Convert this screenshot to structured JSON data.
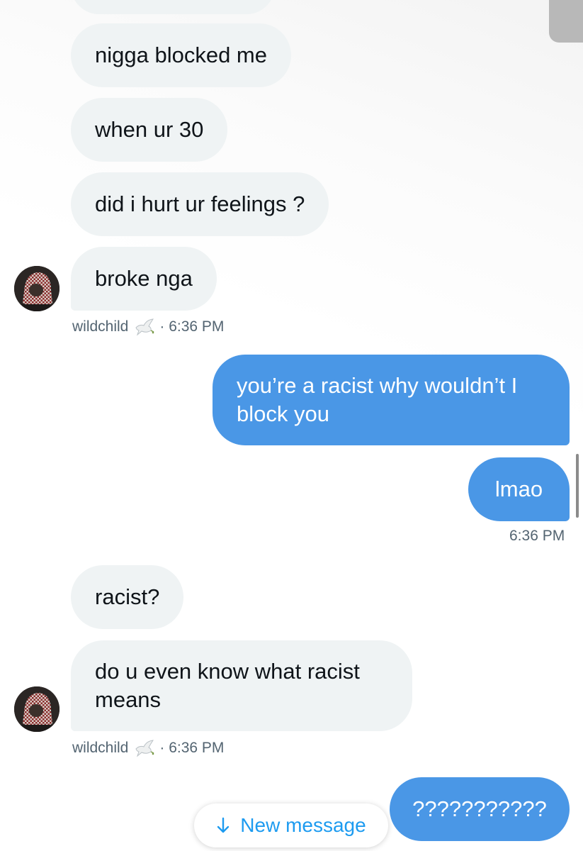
{
  "messages": {
    "received_1": "nigga blocked me",
    "received_2": "when ur 30",
    "received_3": "did i hurt ur feelings ?",
    "received_4": "broke nga",
    "sent_1": "you’re a racist why wouldn’t I block you",
    "sent_2": "lmao",
    "received_5": "racist?",
    "received_6": "do u even know what racist means",
    "sent_3": "???????????"
  },
  "meta": {
    "sender_name_1": "wildchild",
    "sender_time_1": "· 6:36 PM",
    "sent_time_1": "6:36 PM",
    "sender_name_2": "wildchild",
    "sender_time_2": "· 6:36 PM",
    "sender_badge_icon": "dove-icon"
  },
  "new_message_pill": {
    "label": "New message",
    "icon": "arrow-down-icon"
  },
  "colors": {
    "incoming_bubble": "#eff3f4",
    "outgoing_bubble": "#4a97e6",
    "accent": "#1d9bf0",
    "meta_text": "#536471"
  }
}
